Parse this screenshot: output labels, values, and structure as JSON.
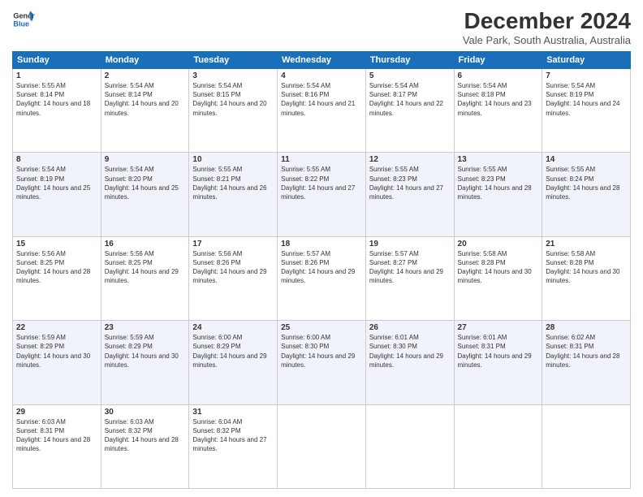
{
  "logo": {
    "line1": "General",
    "line2": "Blue"
  },
  "title": "December 2024",
  "subtitle": "Vale Park, South Australia, Australia",
  "header_days": [
    "Sunday",
    "Monday",
    "Tuesday",
    "Wednesday",
    "Thursday",
    "Friday",
    "Saturday"
  ],
  "weeks": [
    [
      {
        "day": "1",
        "sunrise": "5:55 AM",
        "sunset": "8:14 PM",
        "daylight": "14 hours and 18 minutes."
      },
      {
        "day": "2",
        "sunrise": "5:54 AM",
        "sunset": "8:14 PM",
        "daylight": "14 hours and 20 minutes."
      },
      {
        "day": "3",
        "sunrise": "5:54 AM",
        "sunset": "8:15 PM",
        "daylight": "14 hours and 20 minutes."
      },
      {
        "day": "4",
        "sunrise": "5:54 AM",
        "sunset": "8:16 PM",
        "daylight": "14 hours and 21 minutes."
      },
      {
        "day": "5",
        "sunrise": "5:54 AM",
        "sunset": "8:17 PM",
        "daylight": "14 hours and 22 minutes."
      },
      {
        "day": "6",
        "sunrise": "5:54 AM",
        "sunset": "8:18 PM",
        "daylight": "14 hours and 23 minutes."
      },
      {
        "day": "7",
        "sunrise": "5:54 AM",
        "sunset": "8:19 PM",
        "daylight": "14 hours and 24 minutes."
      }
    ],
    [
      {
        "day": "8",
        "sunrise": "5:54 AM",
        "sunset": "8:19 PM",
        "daylight": "14 hours and 25 minutes."
      },
      {
        "day": "9",
        "sunrise": "5:54 AM",
        "sunset": "8:20 PM",
        "daylight": "14 hours and 25 minutes."
      },
      {
        "day": "10",
        "sunrise": "5:55 AM",
        "sunset": "8:21 PM",
        "daylight": "14 hours and 26 minutes."
      },
      {
        "day": "11",
        "sunrise": "5:55 AM",
        "sunset": "8:22 PM",
        "daylight": "14 hours and 27 minutes."
      },
      {
        "day": "12",
        "sunrise": "5:55 AM",
        "sunset": "8:23 PM",
        "daylight": "14 hours and 27 minutes."
      },
      {
        "day": "13",
        "sunrise": "5:55 AM",
        "sunset": "8:23 PM",
        "daylight": "14 hours and 28 minutes."
      },
      {
        "day": "14",
        "sunrise": "5:55 AM",
        "sunset": "8:24 PM",
        "daylight": "14 hours and 28 minutes."
      }
    ],
    [
      {
        "day": "15",
        "sunrise": "5:56 AM",
        "sunset": "8:25 PM",
        "daylight": "14 hours and 28 minutes."
      },
      {
        "day": "16",
        "sunrise": "5:56 AM",
        "sunset": "8:25 PM",
        "daylight": "14 hours and 29 minutes."
      },
      {
        "day": "17",
        "sunrise": "5:56 AM",
        "sunset": "8:26 PM",
        "daylight": "14 hours and 29 minutes."
      },
      {
        "day": "18",
        "sunrise": "5:57 AM",
        "sunset": "8:26 PM",
        "daylight": "14 hours and 29 minutes."
      },
      {
        "day": "19",
        "sunrise": "5:57 AM",
        "sunset": "8:27 PM",
        "daylight": "14 hours and 29 minutes."
      },
      {
        "day": "20",
        "sunrise": "5:58 AM",
        "sunset": "8:28 PM",
        "daylight": "14 hours and 30 minutes."
      },
      {
        "day": "21",
        "sunrise": "5:58 AM",
        "sunset": "8:28 PM",
        "daylight": "14 hours and 30 minutes."
      }
    ],
    [
      {
        "day": "22",
        "sunrise": "5:59 AM",
        "sunset": "8:29 PM",
        "daylight": "14 hours and 30 minutes."
      },
      {
        "day": "23",
        "sunrise": "5:59 AM",
        "sunset": "8:29 PM",
        "daylight": "14 hours and 30 minutes."
      },
      {
        "day": "24",
        "sunrise": "6:00 AM",
        "sunset": "8:29 PM",
        "daylight": "14 hours and 29 minutes."
      },
      {
        "day": "25",
        "sunrise": "6:00 AM",
        "sunset": "8:30 PM",
        "daylight": "14 hours and 29 minutes."
      },
      {
        "day": "26",
        "sunrise": "6:01 AM",
        "sunset": "8:30 PM",
        "daylight": "14 hours and 29 minutes."
      },
      {
        "day": "27",
        "sunrise": "6:01 AM",
        "sunset": "8:31 PM",
        "daylight": "14 hours and 29 minutes."
      },
      {
        "day": "28",
        "sunrise": "6:02 AM",
        "sunset": "8:31 PM",
        "daylight": "14 hours and 28 minutes."
      }
    ],
    [
      {
        "day": "29",
        "sunrise": "6:03 AM",
        "sunset": "8:31 PM",
        "daylight": "14 hours and 28 minutes."
      },
      {
        "day": "30",
        "sunrise": "6:03 AM",
        "sunset": "8:32 PM",
        "daylight": "14 hours and 28 minutes."
      },
      {
        "day": "31",
        "sunrise": "6:04 AM",
        "sunset": "8:32 PM",
        "daylight": "14 hours and 27 minutes."
      },
      null,
      null,
      null,
      null
    ]
  ]
}
